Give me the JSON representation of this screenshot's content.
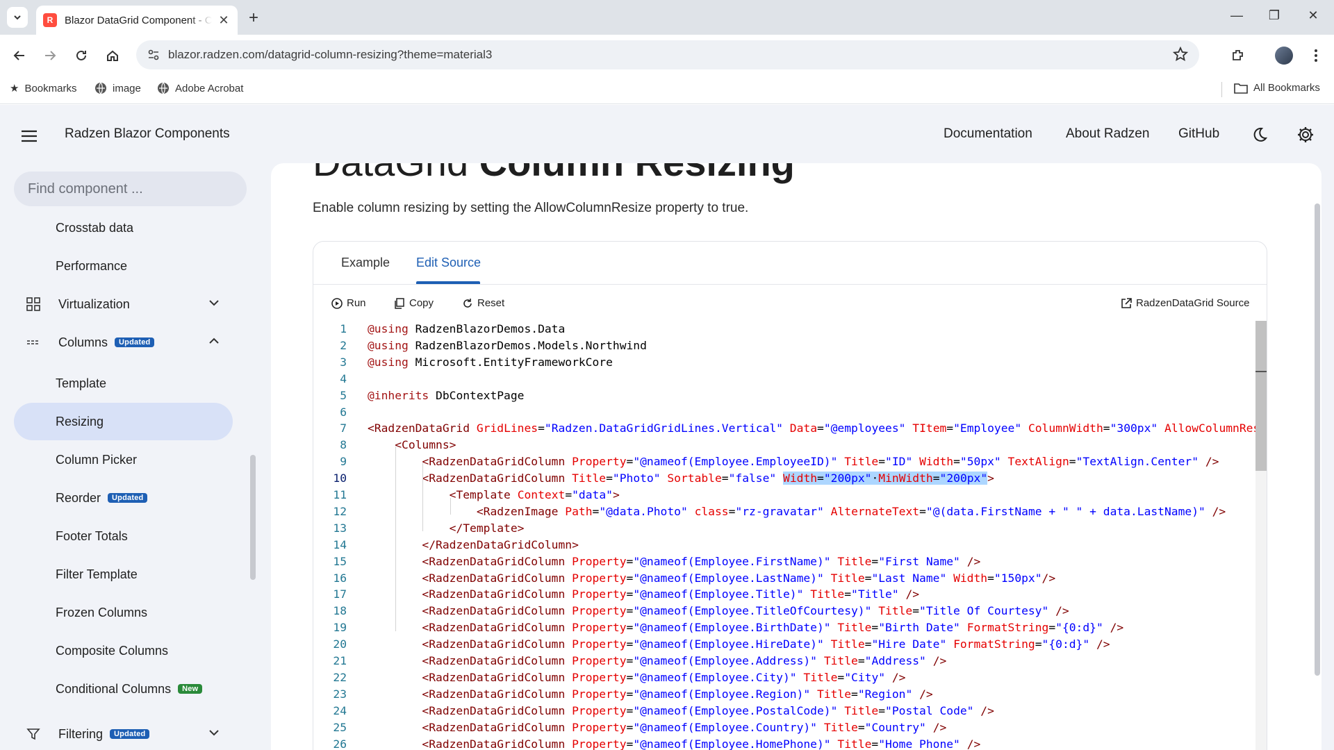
{
  "browser": {
    "tab_title": "Blazor DataGrid Component - C",
    "favicon_letter": "R",
    "url": "blazor.radzen.com/datagrid-column-resizing?theme=material3",
    "bookmarks": [
      "Bookmarks",
      "image",
      "Adobe Acrobat"
    ],
    "all_bookmarks": "All Bookmarks"
  },
  "header": {
    "title": "Radzen Blazor Components",
    "nav": [
      "Documentation",
      "About Radzen",
      "GitHub"
    ]
  },
  "sidebar": {
    "search_placeholder": "Find component ...",
    "items": [
      {
        "label": "Crosstab data"
      },
      {
        "label": "Performance"
      },
      {
        "label": "Virtualization"
      },
      {
        "label": "Columns",
        "badge": "Updated"
      },
      {
        "label": "Template"
      },
      {
        "label": "Resizing"
      },
      {
        "label": "Column Picker"
      },
      {
        "label": "Reorder",
        "badge": "Updated"
      },
      {
        "label": "Footer Totals"
      },
      {
        "label": "Filter Template"
      },
      {
        "label": "Frozen Columns"
      },
      {
        "label": "Composite Columns"
      },
      {
        "label": "Conditional Columns",
        "badge": "New"
      },
      {
        "label": "Filtering",
        "badge": "Updated"
      }
    ]
  },
  "page": {
    "heading_light": "DataGrid ",
    "heading_bold": "Column Resizing",
    "description": "Enable column resizing by setting the AllowColumnResize property to true."
  },
  "card": {
    "tabs": [
      "Example",
      "Edit Source"
    ],
    "active_tab": "Edit Source",
    "actions": {
      "run": "Run",
      "copy": "Copy",
      "reset": "Reset",
      "source": "RadzenDataGrid Source"
    }
  },
  "editor": {
    "current_line": 10,
    "lines": [
      [
        [
          "kw",
          "@using"
        ],
        [
          "txt",
          " RadzenBlazorDemos.Data"
        ]
      ],
      [
        [
          "kw",
          "@using"
        ],
        [
          "txt",
          " RadzenBlazorDemos.Models.Northwind"
        ]
      ],
      [
        [
          "kw",
          "@using"
        ],
        [
          "txt",
          " Microsoft.EntityFrameworkCore"
        ]
      ],
      [],
      [
        [
          "kw",
          "@inherits"
        ],
        [
          "txt",
          " DbContextPage"
        ]
      ],
      [],
      [
        [
          "tag",
          "<RadzenDataGrid"
        ],
        [
          "txt",
          " "
        ],
        [
          "attr",
          "GridLines"
        ],
        [
          "txt",
          "="
        ],
        [
          "str",
          "\"Radzen.DataGridGridLines.Vertical\""
        ],
        [
          "txt",
          " "
        ],
        [
          "attr",
          "Data"
        ],
        [
          "txt",
          "="
        ],
        [
          "str",
          "\"@employees\""
        ],
        [
          "txt",
          " "
        ],
        [
          "attr",
          "TItem"
        ],
        [
          "txt",
          "="
        ],
        [
          "str",
          "\"Employee\""
        ],
        [
          "txt",
          " "
        ],
        [
          "attr",
          "ColumnWidth"
        ],
        [
          "txt",
          "="
        ],
        [
          "str",
          "\"300px\""
        ],
        [
          "txt",
          " "
        ],
        [
          "attr",
          "AllowColumnResize"
        ],
        [
          "txt",
          "="
        ]
      ],
      [
        [
          "txt",
          "    "
        ],
        [
          "tag",
          "<Columns>"
        ]
      ],
      [
        [
          "txt",
          "        "
        ],
        [
          "tag",
          "<RadzenDataGridColumn"
        ],
        [
          "txt",
          " "
        ],
        [
          "attr",
          "Property"
        ],
        [
          "txt",
          "="
        ],
        [
          "str",
          "\"@nameof(Employee.EmployeeID)\""
        ],
        [
          "txt",
          " "
        ],
        [
          "attr",
          "Title"
        ],
        [
          "txt",
          "="
        ],
        [
          "str",
          "\"ID\""
        ],
        [
          "txt",
          " "
        ],
        [
          "attr",
          "Width"
        ],
        [
          "txt",
          "="
        ],
        [
          "str",
          "\"50px\""
        ],
        [
          "txt",
          " "
        ],
        [
          "attr",
          "TextAlign"
        ],
        [
          "txt",
          "="
        ],
        [
          "str",
          "\"TextAlign.Center\""
        ],
        [
          "txt",
          " "
        ],
        [
          "tag",
          "/>"
        ]
      ],
      [
        [
          "txt",
          "        "
        ],
        [
          "tag",
          "<RadzenDataGridColumn"
        ],
        [
          "txt",
          " "
        ],
        [
          "attr",
          "Title"
        ],
        [
          "txt",
          "="
        ],
        [
          "str",
          "\"Photo\""
        ],
        [
          "txt",
          " "
        ],
        [
          "attr",
          "Sortable"
        ],
        [
          "txt",
          "="
        ],
        [
          "str",
          "\"false\""
        ],
        [
          "txt",
          " "
        ],
        [
          "sel-attr",
          "Width"
        ],
        [
          "sel-txt",
          "="
        ],
        [
          "sel-str",
          "\"200px\""
        ],
        [
          "sel-txt",
          "·"
        ],
        [
          "sel-attr",
          "MinWidth"
        ],
        [
          "sel-txt",
          "="
        ],
        [
          "sel-str",
          "\"200px\""
        ],
        [
          "tag",
          ">"
        ]
      ],
      [
        [
          "txt",
          "            "
        ],
        [
          "tag",
          "<Template"
        ],
        [
          "txt",
          " "
        ],
        [
          "attr",
          "Context"
        ],
        [
          "txt",
          "="
        ],
        [
          "str",
          "\"data\""
        ],
        [
          "tag",
          ">"
        ]
      ],
      [
        [
          "txt",
          "                "
        ],
        [
          "tag",
          "<RadzenImage"
        ],
        [
          "txt",
          " "
        ],
        [
          "attr",
          "Path"
        ],
        [
          "txt",
          "="
        ],
        [
          "str",
          "\"@data.Photo\""
        ],
        [
          "txt",
          " "
        ],
        [
          "attr",
          "class"
        ],
        [
          "txt",
          "="
        ],
        [
          "str",
          "\"rz-gravatar\""
        ],
        [
          "txt",
          " "
        ],
        [
          "attr",
          "AlternateText"
        ],
        [
          "txt",
          "="
        ],
        [
          "str",
          "\"@(data.FirstName + \" \" + data.LastName)\""
        ],
        [
          "txt",
          " "
        ],
        [
          "tag",
          "/>"
        ]
      ],
      [
        [
          "txt",
          "            "
        ],
        [
          "tag",
          "</Template>"
        ]
      ],
      [
        [
          "txt",
          "        "
        ],
        [
          "tag",
          "</RadzenDataGridColumn>"
        ]
      ],
      [
        [
          "txt",
          "        "
        ],
        [
          "tag",
          "<RadzenDataGridColumn"
        ],
        [
          "txt",
          " "
        ],
        [
          "attr",
          "Property"
        ],
        [
          "txt",
          "="
        ],
        [
          "str",
          "\"@nameof(Employee.FirstName)\""
        ],
        [
          "txt",
          " "
        ],
        [
          "attr",
          "Title"
        ],
        [
          "txt",
          "="
        ],
        [
          "str",
          "\"First Name\""
        ],
        [
          "txt",
          " "
        ],
        [
          "tag",
          "/>"
        ]
      ],
      [
        [
          "txt",
          "        "
        ],
        [
          "tag",
          "<RadzenDataGridColumn"
        ],
        [
          "txt",
          " "
        ],
        [
          "attr",
          "Property"
        ],
        [
          "txt",
          "="
        ],
        [
          "str",
          "\"@nameof(Employee.LastName)\""
        ],
        [
          "txt",
          " "
        ],
        [
          "attr",
          "Title"
        ],
        [
          "txt",
          "="
        ],
        [
          "str",
          "\"Last Name\""
        ],
        [
          "txt",
          " "
        ],
        [
          "attr",
          "Width"
        ],
        [
          "txt",
          "="
        ],
        [
          "str",
          "\"150px\""
        ],
        [
          "tag",
          "/>"
        ]
      ],
      [
        [
          "txt",
          "        "
        ],
        [
          "tag",
          "<RadzenDataGridColumn"
        ],
        [
          "txt",
          " "
        ],
        [
          "attr",
          "Property"
        ],
        [
          "txt",
          "="
        ],
        [
          "str",
          "\"@nameof(Employee.Title)\""
        ],
        [
          "txt",
          " "
        ],
        [
          "attr",
          "Title"
        ],
        [
          "txt",
          "="
        ],
        [
          "str",
          "\"Title\""
        ],
        [
          "txt",
          " "
        ],
        [
          "tag",
          "/>"
        ]
      ],
      [
        [
          "txt",
          "        "
        ],
        [
          "tag",
          "<RadzenDataGridColumn"
        ],
        [
          "txt",
          " "
        ],
        [
          "attr",
          "Property"
        ],
        [
          "txt",
          "="
        ],
        [
          "str",
          "\"@nameof(Employee.TitleOfCourtesy)\""
        ],
        [
          "txt",
          " "
        ],
        [
          "attr",
          "Title"
        ],
        [
          "txt",
          "="
        ],
        [
          "str",
          "\"Title Of Courtesy\""
        ],
        [
          "txt",
          " "
        ],
        [
          "tag",
          "/>"
        ]
      ],
      [
        [
          "txt",
          "        "
        ],
        [
          "tag",
          "<RadzenDataGridColumn"
        ],
        [
          "txt",
          " "
        ],
        [
          "attr",
          "Property"
        ],
        [
          "txt",
          "="
        ],
        [
          "str",
          "\"@nameof(Employee.BirthDate)\""
        ],
        [
          "txt",
          " "
        ],
        [
          "attr",
          "Title"
        ],
        [
          "txt",
          "="
        ],
        [
          "str",
          "\"Birth Date\""
        ],
        [
          "txt",
          " "
        ],
        [
          "attr",
          "FormatString"
        ],
        [
          "txt",
          "="
        ],
        [
          "str",
          "\"{0:d}\""
        ],
        [
          "txt",
          " "
        ],
        [
          "tag",
          "/>"
        ]
      ],
      [
        [
          "txt",
          "        "
        ],
        [
          "tag",
          "<RadzenDataGridColumn"
        ],
        [
          "txt",
          " "
        ],
        [
          "attr",
          "Property"
        ],
        [
          "txt",
          "="
        ],
        [
          "str",
          "\"@nameof(Employee.HireDate)\""
        ],
        [
          "txt",
          " "
        ],
        [
          "attr",
          "Title"
        ],
        [
          "txt",
          "="
        ],
        [
          "str",
          "\"Hire Date\""
        ],
        [
          "txt",
          " "
        ],
        [
          "attr",
          "FormatString"
        ],
        [
          "txt",
          "="
        ],
        [
          "str",
          "\"{0:d}\""
        ],
        [
          "txt",
          " "
        ],
        [
          "tag",
          "/>"
        ]
      ],
      [
        [
          "txt",
          "        "
        ],
        [
          "tag",
          "<RadzenDataGridColumn"
        ],
        [
          "txt",
          " "
        ],
        [
          "attr",
          "Property"
        ],
        [
          "txt",
          "="
        ],
        [
          "str",
          "\"@nameof(Employee.Address)\""
        ],
        [
          "txt",
          " "
        ],
        [
          "attr",
          "Title"
        ],
        [
          "txt",
          "="
        ],
        [
          "str",
          "\"Address\""
        ],
        [
          "txt",
          " "
        ],
        [
          "tag",
          "/>"
        ]
      ],
      [
        [
          "txt",
          "        "
        ],
        [
          "tag",
          "<RadzenDataGridColumn"
        ],
        [
          "txt",
          " "
        ],
        [
          "attr",
          "Property"
        ],
        [
          "txt",
          "="
        ],
        [
          "str",
          "\"@nameof(Employee.City)\""
        ],
        [
          "txt",
          " "
        ],
        [
          "attr",
          "Title"
        ],
        [
          "txt",
          "="
        ],
        [
          "str",
          "\"City\""
        ],
        [
          "txt",
          " "
        ],
        [
          "tag",
          "/>"
        ]
      ],
      [
        [
          "txt",
          "        "
        ],
        [
          "tag",
          "<RadzenDataGridColumn"
        ],
        [
          "txt",
          " "
        ],
        [
          "attr",
          "Property"
        ],
        [
          "txt",
          "="
        ],
        [
          "str",
          "\"@nameof(Employee.Region)\""
        ],
        [
          "txt",
          " "
        ],
        [
          "attr",
          "Title"
        ],
        [
          "txt",
          "="
        ],
        [
          "str",
          "\"Region\""
        ],
        [
          "txt",
          " "
        ],
        [
          "tag",
          "/>"
        ]
      ],
      [
        [
          "txt",
          "        "
        ],
        [
          "tag",
          "<RadzenDataGridColumn"
        ],
        [
          "txt",
          " "
        ],
        [
          "attr",
          "Property"
        ],
        [
          "txt",
          "="
        ],
        [
          "str",
          "\"@nameof(Employee.PostalCode)\""
        ],
        [
          "txt",
          " "
        ],
        [
          "attr",
          "Title"
        ],
        [
          "txt",
          "="
        ],
        [
          "str",
          "\"Postal Code\""
        ],
        [
          "txt",
          " "
        ],
        [
          "tag",
          "/>"
        ]
      ],
      [
        [
          "txt",
          "        "
        ],
        [
          "tag",
          "<RadzenDataGridColumn"
        ],
        [
          "txt",
          " "
        ],
        [
          "attr",
          "Property"
        ],
        [
          "txt",
          "="
        ],
        [
          "str",
          "\"@nameof(Employee.Country)\""
        ],
        [
          "txt",
          " "
        ],
        [
          "attr",
          "Title"
        ],
        [
          "txt",
          "="
        ],
        [
          "str",
          "\"Country\""
        ],
        [
          "txt",
          " "
        ],
        [
          "tag",
          "/>"
        ]
      ],
      [
        [
          "txt",
          "        "
        ],
        [
          "tag",
          "<RadzenDataGridColumn"
        ],
        [
          "txt",
          " "
        ],
        [
          "attr",
          "Property"
        ],
        [
          "txt",
          "="
        ],
        [
          "str",
          "\"@nameof(Employee.HomePhone)\""
        ],
        [
          "txt",
          " "
        ],
        [
          "attr",
          "Title"
        ],
        [
          "txt",
          "="
        ],
        [
          "str",
          "\"Home Phone\""
        ],
        [
          "txt",
          " "
        ],
        [
          "tag",
          "/>"
        ]
      ]
    ]
  },
  "colors": {
    "accent": "#1e5fb4",
    "badge_updated": "#1e5fb4",
    "badge_new": "#2a8a3a",
    "active_nav": "#d8e1f7"
  }
}
